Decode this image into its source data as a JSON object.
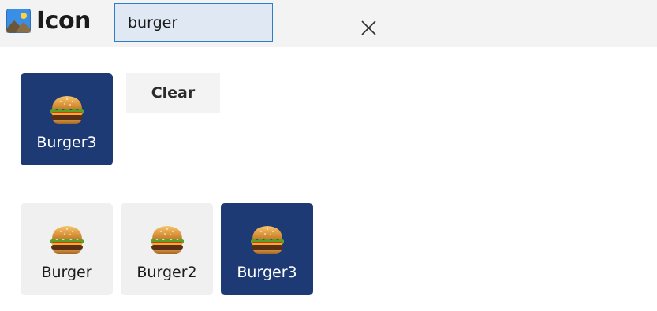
{
  "header": {
    "title": "Icon",
    "logo_icon": "image-icon",
    "search": {
      "value": "burger",
      "placeholder": "",
      "clear_icon": "close-icon"
    }
  },
  "selected": {
    "item": {
      "label": "Burger3",
      "icon": "burger-icon"
    },
    "clear_label": "Clear"
  },
  "results": [
    {
      "label": "Burger",
      "icon": "burger-icon",
      "selected": false
    },
    {
      "label": "Burger2",
      "icon": "burger-icon",
      "selected": false
    },
    {
      "label": "Burger3",
      "icon": "burger-icon",
      "selected": true
    }
  ],
  "colors": {
    "selected_tile": "#1d3a74",
    "normal_tile": "#f0f0f0",
    "header_bg": "#f3f3f3",
    "search_border": "#2d7dc8",
    "search_bg": "#dfe8f3"
  }
}
